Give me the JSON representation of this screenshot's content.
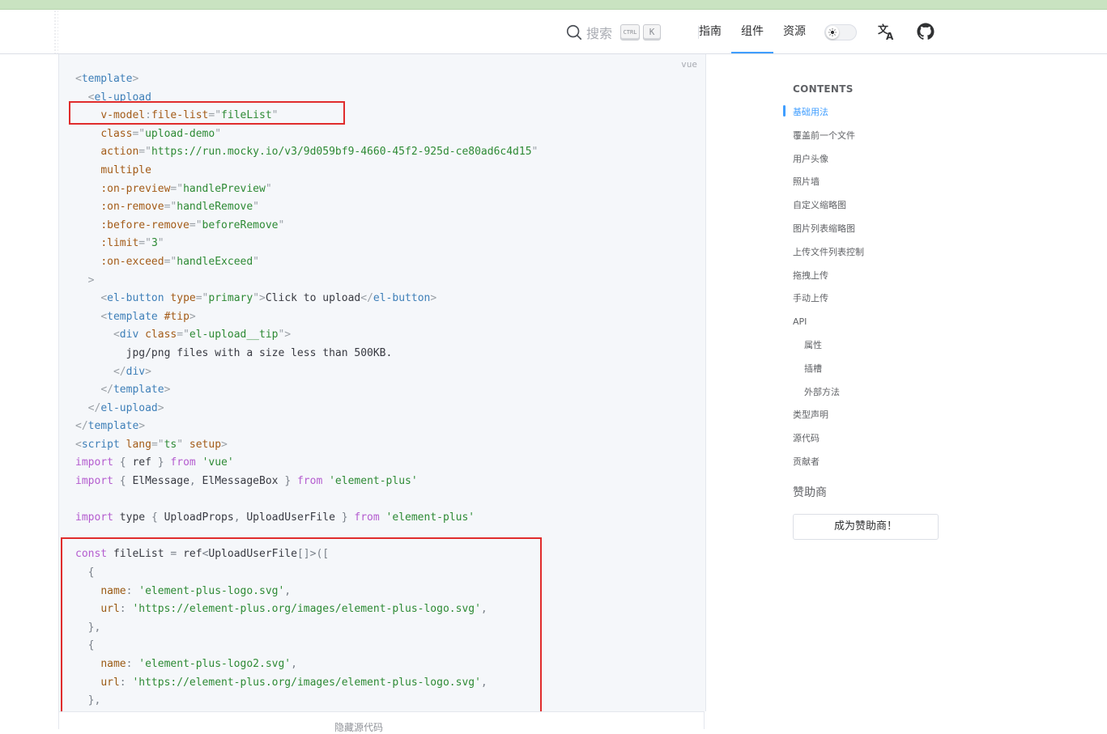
{
  "nav": {
    "search_placeholder": "搜索",
    "kbd_ctrl": "CTRL",
    "kbd_k": "K",
    "links": [
      "指南",
      "组件",
      "资源"
    ],
    "active_link": "组件",
    "theme_toggle_icon": "sun-icon",
    "translate_icon": "translate-icon",
    "github_icon": "github-icon"
  },
  "code": {
    "lang": "vue",
    "footer_label": "隐藏源代码",
    "lines": [
      [
        [
          "br",
          "<"
        ],
        [
          "tag",
          "template"
        ],
        [
          "br",
          ">"
        ]
      ],
      [
        [
          "txt",
          "  "
        ],
        [
          "br",
          "<"
        ],
        [
          "tag",
          "el-upload"
        ]
      ],
      [
        [
          "txt",
          "    "
        ],
        [
          "attr",
          "v-model"
        ],
        [
          "br",
          ":"
        ],
        [
          "attr",
          "file-list"
        ],
        [
          "br",
          "=\""
        ],
        [
          "str",
          "fileList"
        ],
        [
          "br",
          "\""
        ]
      ],
      [
        [
          "txt",
          "    "
        ],
        [
          "attr",
          "class"
        ],
        [
          "br",
          "=\""
        ],
        [
          "str",
          "upload-demo"
        ],
        [
          "br",
          "\""
        ]
      ],
      [
        [
          "txt",
          "    "
        ],
        [
          "attr",
          "action"
        ],
        [
          "br",
          "=\""
        ],
        [
          "str",
          "https://run.mocky.io/v3/9d059bf9-4660-45f2-925d-ce80ad6c4d15"
        ],
        [
          "br",
          "\""
        ]
      ],
      [
        [
          "txt",
          "    "
        ],
        [
          "attr",
          "multiple"
        ]
      ],
      [
        [
          "txt",
          "    "
        ],
        [
          "attr",
          ":on-preview"
        ],
        [
          "br",
          "=\""
        ],
        [
          "str",
          "handlePreview"
        ],
        [
          "br",
          "\""
        ]
      ],
      [
        [
          "txt",
          "    "
        ],
        [
          "attr",
          ":on-remove"
        ],
        [
          "br",
          "=\""
        ],
        [
          "str",
          "handleRemove"
        ],
        [
          "br",
          "\""
        ]
      ],
      [
        [
          "txt",
          "    "
        ],
        [
          "attr",
          ":before-remove"
        ],
        [
          "br",
          "=\""
        ],
        [
          "str",
          "beforeRemove"
        ],
        [
          "br",
          "\""
        ]
      ],
      [
        [
          "txt",
          "    "
        ],
        [
          "attr",
          ":limit"
        ],
        [
          "br",
          "=\""
        ],
        [
          "str",
          "3"
        ],
        [
          "br",
          "\""
        ]
      ],
      [
        [
          "txt",
          "    "
        ],
        [
          "attr",
          ":on-exceed"
        ],
        [
          "br",
          "=\""
        ],
        [
          "str",
          "handleExceed"
        ],
        [
          "br",
          "\""
        ]
      ],
      [
        [
          "txt",
          "  "
        ],
        [
          "br",
          ">"
        ]
      ],
      [
        [
          "txt",
          "    "
        ],
        [
          "br",
          "<"
        ],
        [
          "tag",
          "el-button"
        ],
        [
          "txt",
          " "
        ],
        [
          "attr",
          "type"
        ],
        [
          "br",
          "=\""
        ],
        [
          "str",
          "primary"
        ],
        [
          "br",
          "\">"
        ],
        [
          "txt",
          "Click to upload"
        ],
        [
          "br",
          "</"
        ],
        [
          "tag",
          "el-button"
        ],
        [
          "br",
          ">"
        ]
      ],
      [
        [
          "txt",
          "    "
        ],
        [
          "br",
          "<"
        ],
        [
          "tag",
          "template"
        ],
        [
          "txt",
          " "
        ],
        [
          "attr",
          "#tip"
        ],
        [
          "br",
          ">"
        ]
      ],
      [
        [
          "txt",
          "      "
        ],
        [
          "br",
          "<"
        ],
        [
          "tag",
          "div"
        ],
        [
          "txt",
          " "
        ],
        [
          "attr",
          "class"
        ],
        [
          "br",
          "=\""
        ],
        [
          "str",
          "el-upload__tip"
        ],
        [
          "br",
          "\">"
        ]
      ],
      [
        [
          "txt",
          "        jpg/png files with a size less than 500KB."
        ]
      ],
      [
        [
          "txt",
          "      "
        ],
        [
          "br",
          "</"
        ],
        [
          "tag",
          "div"
        ],
        [
          "br",
          ">"
        ]
      ],
      [
        [
          "txt",
          "    "
        ],
        [
          "br",
          "</"
        ],
        [
          "tag",
          "template"
        ],
        [
          "br",
          ">"
        ]
      ],
      [
        [
          "txt",
          "  "
        ],
        [
          "br",
          "</"
        ],
        [
          "tag",
          "el-upload"
        ],
        [
          "br",
          ">"
        ]
      ],
      [
        [
          "br",
          "</"
        ],
        [
          "tag",
          "template"
        ],
        [
          "br",
          ">"
        ]
      ],
      [
        [
          "br",
          "<"
        ],
        [
          "tag",
          "script"
        ],
        [
          "txt",
          " "
        ],
        [
          "attr",
          "lang"
        ],
        [
          "br",
          "=\""
        ],
        [
          "str",
          "ts"
        ],
        [
          "br",
          "\""
        ],
        [
          "txt",
          " "
        ],
        [
          "attr",
          "setup"
        ],
        [
          "br",
          ">"
        ]
      ],
      [
        [
          "kw",
          "import"
        ],
        [
          "txt",
          " "
        ],
        [
          "punc",
          "{"
        ],
        [
          "txt",
          " ref "
        ],
        [
          "punc",
          "}"
        ],
        [
          "txt",
          " "
        ],
        [
          "kw",
          "from"
        ],
        [
          "txt",
          " "
        ],
        [
          "sq",
          "'vue'"
        ]
      ],
      [
        [
          "kw",
          "import"
        ],
        [
          "txt",
          " "
        ],
        [
          "punc",
          "{"
        ],
        [
          "txt",
          " ElMessage"
        ],
        [
          "punc",
          ","
        ],
        [
          "txt",
          " ElMessageBox "
        ],
        [
          "punc",
          "}"
        ],
        [
          "txt",
          " "
        ],
        [
          "kw",
          "from"
        ],
        [
          "txt",
          " "
        ],
        [
          "sq",
          "'element-plus'"
        ]
      ],
      [
        [
          "txt",
          " "
        ]
      ],
      [
        [
          "kw",
          "import"
        ],
        [
          "txt",
          " type "
        ],
        [
          "punc",
          "{"
        ],
        [
          "txt",
          " UploadProps"
        ],
        [
          "punc",
          ","
        ],
        [
          "txt",
          " UploadUserFile "
        ],
        [
          "punc",
          "}"
        ],
        [
          "txt",
          " "
        ],
        [
          "kw",
          "from"
        ],
        [
          "txt",
          " "
        ],
        [
          "sq",
          "'element-plus'"
        ]
      ],
      [
        [
          "txt",
          " "
        ]
      ],
      [
        [
          "kw",
          "const"
        ],
        [
          "txt",
          " fileList "
        ],
        [
          "punc",
          "="
        ],
        [
          "txt",
          " ref"
        ],
        [
          "punc",
          "<"
        ],
        [
          "txt",
          "UploadUserFile"
        ],
        [
          "punc",
          "[]>(["
        ]
      ],
      [
        [
          "txt",
          "  "
        ],
        [
          "punc",
          "{"
        ]
      ],
      [
        [
          "txt",
          "    "
        ],
        [
          "prop",
          "name"
        ],
        [
          "punc",
          ":"
        ],
        [
          "txt",
          " "
        ],
        [
          "sq",
          "'element-plus-logo.svg'"
        ],
        [
          "punc",
          ","
        ]
      ],
      [
        [
          "txt",
          "    "
        ],
        [
          "prop",
          "url"
        ],
        [
          "punc",
          ":"
        ],
        [
          "txt",
          " "
        ],
        [
          "sq",
          "'https://element-plus.org/images/element-plus-logo.svg'"
        ],
        [
          "punc",
          ","
        ]
      ],
      [
        [
          "txt",
          "  "
        ],
        [
          "punc",
          "},"
        ]
      ],
      [
        [
          "txt",
          "  "
        ],
        [
          "punc",
          "{"
        ]
      ],
      [
        [
          "txt",
          "    "
        ],
        [
          "prop",
          "name"
        ],
        [
          "punc",
          ":"
        ],
        [
          "txt",
          " "
        ],
        [
          "sq",
          "'element-plus-logo2.svg'"
        ],
        [
          "punc",
          ","
        ]
      ],
      [
        [
          "txt",
          "    "
        ],
        [
          "prop",
          "url"
        ],
        [
          "punc",
          ":"
        ],
        [
          "txt",
          " "
        ],
        [
          "sq",
          "'https://element-plus.org/images/element-plus-logo.svg'"
        ],
        [
          "punc",
          ","
        ]
      ],
      [
        [
          "txt",
          "  "
        ],
        [
          "punc",
          "},"
        ]
      ]
    ]
  },
  "toc": {
    "title": "CONTENTS",
    "items": [
      {
        "label": "基础用法",
        "sub": false,
        "active": true
      },
      {
        "label": "覆盖前一个文件",
        "sub": false,
        "active": false
      },
      {
        "label": "用户头像",
        "sub": false,
        "active": false
      },
      {
        "label": "照片墙",
        "sub": false,
        "active": false
      },
      {
        "label": "自定义缩略图",
        "sub": false,
        "active": false
      },
      {
        "label": "图片列表缩略图",
        "sub": false,
        "active": false
      },
      {
        "label": "上传文件列表控制",
        "sub": false,
        "active": false
      },
      {
        "label": "拖拽上传",
        "sub": false,
        "active": false
      },
      {
        "label": "手动上传",
        "sub": false,
        "active": false
      },
      {
        "label": "API",
        "sub": false,
        "active": false
      },
      {
        "label": "属性",
        "sub": true,
        "active": false
      },
      {
        "label": "插槽",
        "sub": true,
        "active": false
      },
      {
        "label": "外部方法",
        "sub": true,
        "active": false
      },
      {
        "label": "类型声明",
        "sub": false,
        "active": false
      },
      {
        "label": "源代码",
        "sub": false,
        "active": false
      },
      {
        "label": "贡献者",
        "sub": false,
        "active": false
      }
    ]
  },
  "sponsor": {
    "title": "赞助商",
    "button": "成为赞助商！"
  },
  "colors": {
    "accent": "#409eff",
    "highlight_box": "#e02c2c",
    "top_band": "#c9e3c1"
  }
}
